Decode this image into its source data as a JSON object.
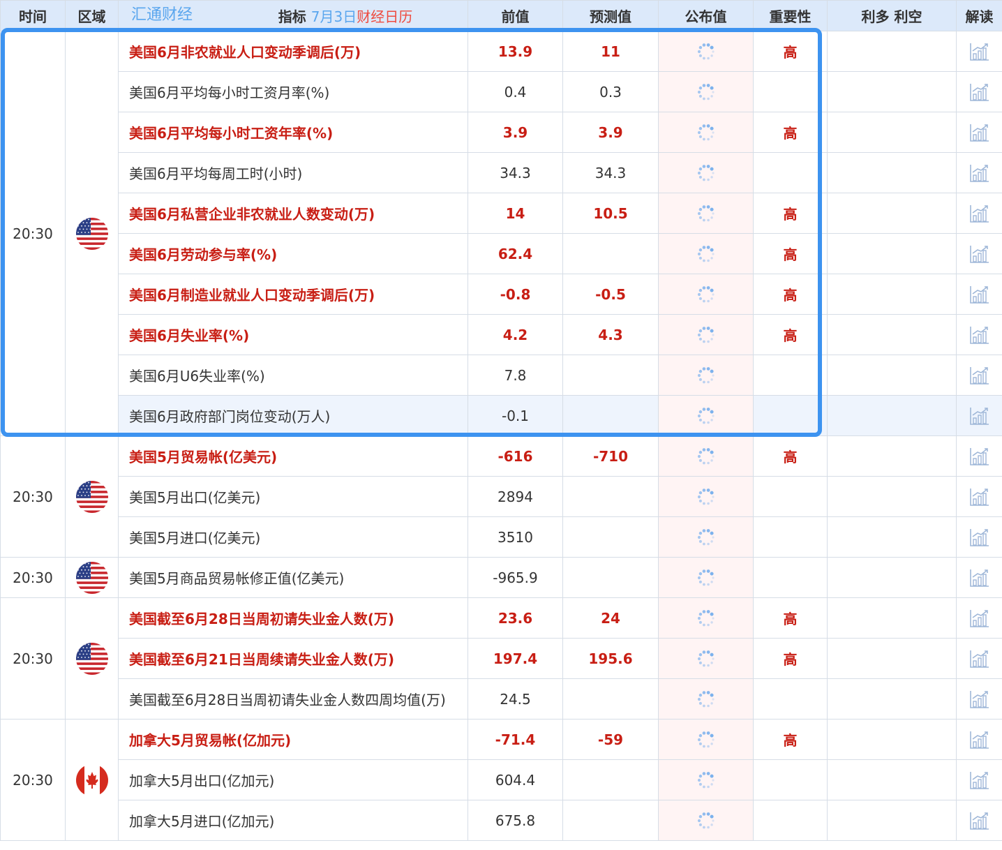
{
  "header": {
    "time": "时间",
    "region": "区域",
    "brand": "汇通财经",
    "indicator_label": "指标",
    "date": "7月3日",
    "calendar_suffix": "财经日历",
    "previous": "前值",
    "forecast": "预测值",
    "actual": "公布值",
    "importance": "重要性",
    "bull_bear": "利多 利空",
    "interpretation": "解读"
  },
  "colors": {
    "highlight_red": "#c81e14",
    "header_bg": "#dce9fa",
    "selection_blue": "#3d93f0",
    "actual_bg": "#fff4f4"
  },
  "groups": [
    {
      "time": "20:30",
      "flag": "us-flag-icon",
      "rows": [
        {
          "name": "美国6月非农就业人口变动季调后(万)",
          "prev": "13.9",
          "forecast": "11",
          "importance": "高",
          "hi": true
        },
        {
          "name": "美国6月平均每小时工资月率(%)",
          "prev": "0.4",
          "forecast": "0.3",
          "importance": "",
          "hi": false
        },
        {
          "name": "美国6月平均每小时工资年率(%)",
          "prev": "3.9",
          "forecast": "3.9",
          "importance": "高",
          "hi": true
        },
        {
          "name": "美国6月平均每周工时(小时)",
          "prev": "34.3",
          "forecast": "34.3",
          "importance": "",
          "hi": false
        },
        {
          "name": "美国6月私营企业非农就业人数变动(万)",
          "prev": "14",
          "forecast": "10.5",
          "importance": "高",
          "hi": true
        },
        {
          "name": "美国6月劳动参与率(%)",
          "prev": "62.4",
          "forecast": "",
          "importance": "高",
          "hi": true
        },
        {
          "name": "美国6月制造业就业人口变动季调后(万)",
          "prev": "-0.8",
          "forecast": "-0.5",
          "importance": "高",
          "hi": true
        },
        {
          "name": "美国6月失业率(%)",
          "prev": "4.2",
          "forecast": "4.3",
          "importance": "高",
          "hi": true
        },
        {
          "name": "美国6月U6失业率(%)",
          "prev": "7.8",
          "forecast": "",
          "importance": "",
          "hi": false
        },
        {
          "name": "美国6月政府部门岗位变动(万人)",
          "prev": "-0.1",
          "forecast": "",
          "importance": "",
          "hi": false,
          "hover": true
        }
      ]
    },
    {
      "time": "20:30",
      "flag": "us-flag-icon",
      "rows": [
        {
          "name": "美国5月贸易帐(亿美元)",
          "prev": "-616",
          "forecast": "-710",
          "importance": "高",
          "hi": true
        },
        {
          "name": "美国5月出口(亿美元)",
          "prev": "2894",
          "forecast": "",
          "importance": "",
          "hi": false
        },
        {
          "name": "美国5月进口(亿美元)",
          "prev": "3510",
          "forecast": "",
          "importance": "",
          "hi": false
        }
      ]
    },
    {
      "time": "20:30",
      "flag": "us-flag-icon",
      "rows": [
        {
          "name": "美国5月商品贸易帐修正值(亿美元)",
          "prev": "-965.9",
          "forecast": "",
          "importance": "",
          "hi": false
        }
      ]
    },
    {
      "time": "20:30",
      "flag": "us-flag-icon",
      "rows": [
        {
          "name": "美国截至6月28日当周初请失业金人数(万)",
          "prev": "23.6",
          "forecast": "24",
          "importance": "高",
          "hi": true
        },
        {
          "name": "美国截至6月21日当周续请失业金人数(万)",
          "prev": "197.4",
          "forecast": "195.6",
          "importance": "高",
          "hi": true
        },
        {
          "name": "美国截至6月28日当周初请失业金人数四周均值(万)",
          "prev": "24.5",
          "forecast": "",
          "importance": "",
          "hi": false
        }
      ]
    },
    {
      "time": "20:30",
      "flag": "ca-flag-icon",
      "rows": [
        {
          "name": "加拿大5月贸易帐(亿加元)",
          "prev": "-71.4",
          "forecast": "-59",
          "importance": "高",
          "hi": true
        },
        {
          "name": "加拿大5月出口(亿加元)",
          "prev": "604.4",
          "forecast": "",
          "importance": "",
          "hi": false
        },
        {
          "name": "加拿大5月进口(亿加元)",
          "prev": "675.8",
          "forecast": "",
          "importance": "",
          "hi": false
        }
      ]
    }
  ]
}
